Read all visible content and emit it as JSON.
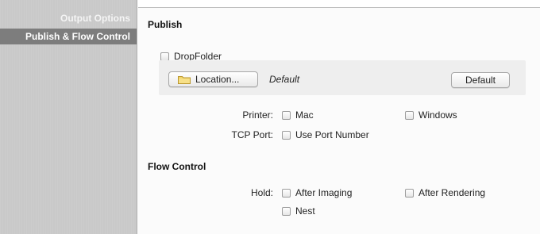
{
  "sidebar": {
    "items": [
      {
        "label": "Output Options",
        "active": false
      },
      {
        "label": "Publish & Flow Control",
        "active": true
      }
    ]
  },
  "publish": {
    "title": "Publish",
    "dropfolder_label": "DropFolder",
    "location_button": "Location...",
    "location_value": "Default",
    "default_button": "Default",
    "printer_label": "Printer:",
    "printer_options": [
      "Mac",
      "Windows"
    ],
    "tcp_label": "TCP Port:",
    "tcp_option": "Use Port Number"
  },
  "flow_control": {
    "title": "Flow Control",
    "hold_label": "Hold:",
    "hold_options": [
      "After Imaging",
      "After Rendering",
      "Nest"
    ]
  },
  "icons": {
    "folder": "folder-icon"
  }
}
